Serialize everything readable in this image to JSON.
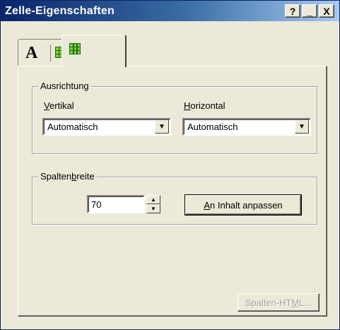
{
  "window": {
    "title": "Zelle-Eigenschaften",
    "help_glyph": "?",
    "minimize_glyph": "_",
    "close_glyph": "X"
  },
  "tabs": [
    {
      "label": "A",
      "icon": "text-format-icon"
    },
    {
      "icon": "table-grid-icon"
    },
    {
      "icon": "column-grid-icon",
      "selected": true
    }
  ],
  "alignment": {
    "legend": "Ausrichtung",
    "vertical": {
      "label_mnemonic": "V",
      "label_rest": "ertikal",
      "value": "Automatisch"
    },
    "horizontal": {
      "label_mnemonic": "H",
      "label_rest": "orizontal",
      "value": "Automatisch"
    }
  },
  "column_width": {
    "legend_pre": "Spalten",
    "legend_mnemonic": "b",
    "legend_post": "reite",
    "value": "70",
    "fit_button": {
      "mnemonic": "A",
      "rest": "n Inhalt anpassen"
    }
  },
  "column_html_button": {
    "pre": "Spalten-HT",
    "mnemonic": "M",
    "post": "L..."
  },
  "colors": {
    "title_gradient_start": "#0a246a",
    "title_gradient_end": "#a6caf0",
    "face": "#ece9d8",
    "icon_green": "#7fcc3f"
  }
}
